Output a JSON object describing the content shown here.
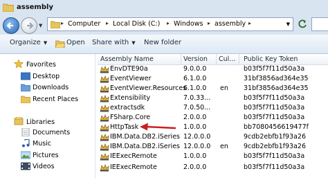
{
  "window": {
    "title": "assembly"
  },
  "address": {
    "crumbs": [
      "Computer",
      "Local Disk (C:)",
      "Windows",
      "assembly"
    ]
  },
  "toolbar": {
    "organize": "Organize",
    "open": "Open",
    "share_with": "Share with",
    "new_folder": "New folder"
  },
  "nav": {
    "favorites": "Favorites",
    "desktop": "Desktop",
    "downloads": "Downloads",
    "recent_places": "Recent Places",
    "libraries": "Libraries",
    "documents": "Documents",
    "music": "Music",
    "pictures": "Pictures",
    "videos": "Videos"
  },
  "columns": {
    "name": "Assembly Name",
    "version": "Version",
    "culture": "Cul...",
    "token": "Public Key Token"
  },
  "rows": [
    {
      "name": "EnvDTE90a",
      "version": "9.0.0.0",
      "culture": "",
      "token": "b03f5f7f11d50a3a"
    },
    {
      "name": "EventViewer",
      "version": "6.1.0.0",
      "culture": "",
      "token": "31bf3856ad364e35"
    },
    {
      "name": "EventViewer.Resources",
      "version": "6.1.0.0",
      "culture": "en",
      "token": "31bf3856ad364e35"
    },
    {
      "name": "Extensibility",
      "version": "7.0.33...",
      "culture": "",
      "token": "b03f5f7f11d50a3a"
    },
    {
      "name": "extractsdk",
      "version": "7.0.50...",
      "culture": "",
      "token": "b03f5f7f11d50a3a"
    },
    {
      "name": "FSharp.Core",
      "version": "2.0.0.0",
      "culture": "",
      "token": "b03f5f7f11d50a3a"
    },
    {
      "name": "HttpTask",
      "version": "1.0.0.0",
      "culture": "",
      "token": "bb7080456619477f"
    },
    {
      "name": "IBM.Data.DB2.iSeries",
      "version": "12.0.0.0",
      "culture": "",
      "token": "9cdb2ebfb1f93a26"
    },
    {
      "name": "IBM.Data.DB2.iSeries",
      "version": "12.0.0.0",
      "culture": "en",
      "token": "9cdb2ebfb1f93a26"
    },
    {
      "name": "IEExecRemote",
      "version": "1.0.0.0",
      "culture": "",
      "token": "b03f5f7f11d50a3a"
    },
    {
      "name": "IEExecRemote",
      "version": "2.0.0.0",
      "culture": "",
      "token": "b03f5f7f11d50a3a"
    }
  ],
  "colors": {
    "chrome": "#d9e4f1",
    "arrow": "#cc1f1f"
  }
}
